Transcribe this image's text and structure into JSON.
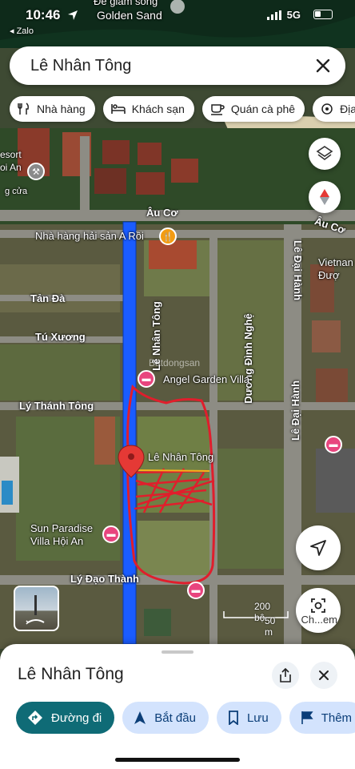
{
  "status_bar": {
    "time": "10:46",
    "network": "5G",
    "back_app": "◂ Zalo"
  },
  "search": {
    "query": "Lê Nhân Tông"
  },
  "chips": [
    {
      "label": "Nhà hàng",
      "icon": "restaurant-icon"
    },
    {
      "label": "Khách sạn",
      "icon": "hotel-icon"
    },
    {
      "label": "Quán cà phê",
      "icon": "cafe-icon"
    },
    {
      "label": "Địa",
      "icon": "attraction-icon"
    }
  ],
  "map": {
    "top_label": "Đề giảm sóng",
    "top_label_2": "Golden Sand",
    "resort_label": "esort\noi An",
    "resort_sub": "g cửa",
    "roads": {
      "au_co_1": "Âu Cơ",
      "au_co_2": "Âu Cơ",
      "le_nhan_tong": "Lê Nhân Tông",
      "duong_dinh_nghe": "Dương Đình Nghệ",
      "le_dai_hanh_1": "Lê Đại Hành",
      "le_dai_hanh_2": "Lê Đại Hành",
      "tan_da": "Tản Đà",
      "tu_xuong": "Tú Xương",
      "ly_thanh_tong": "Lý Thánh Tông",
      "ly_dao_thanh": "Lý Đạo Thành"
    },
    "pois": {
      "restaurant": "Nhà hàng hải sản A Rồi",
      "angel_garden": "Angel Garden Villa",
      "sun_paradise": "Sun Paradise\nVilla Hội An",
      "vietnam": "Vietnan\nĐượ",
      "pin_label": "Lê Nhân Tông"
    },
    "watermark": "Batdongsan",
    "scale_top": "200 bộ",
    "scale_bottom": "50 m",
    "lens_label": "Ch...em"
  },
  "sheet": {
    "title": "Lê Nhân Tông",
    "actions": [
      {
        "label": "Đường đi",
        "icon": "directions-icon"
      },
      {
        "label": "Bắt đầu",
        "icon": "navigation-icon"
      },
      {
        "label": "Lưu",
        "icon": "bookmark-icon"
      },
      {
        "label": "Thêm",
        "icon": "flag-icon"
      }
    ]
  },
  "colors": {
    "route_blue": "#1a5cff",
    "pin_red": "#e53935",
    "accent_teal": "#0f6b76",
    "chip_blue": "#d3e3fd"
  }
}
